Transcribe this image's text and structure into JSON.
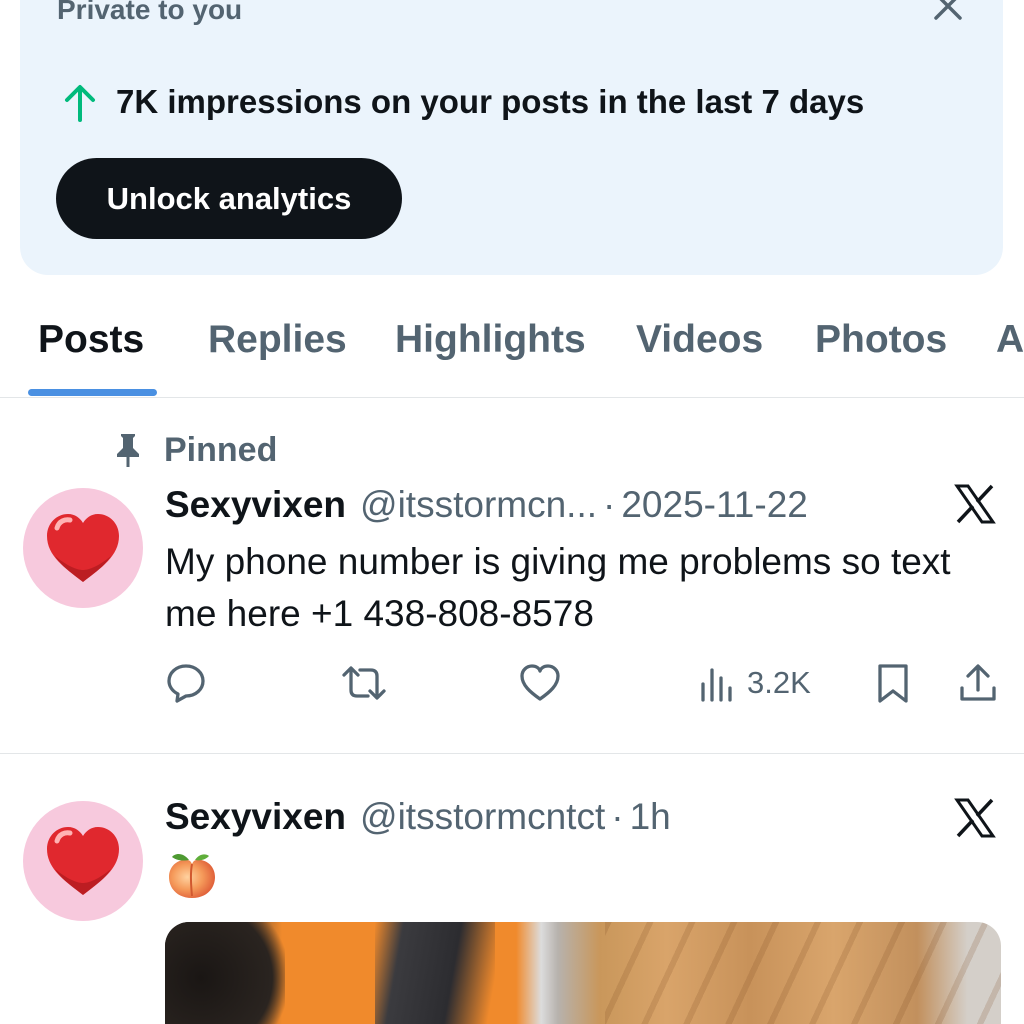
{
  "analytics_card": {
    "private_label": "Private to you",
    "stat_text": "7K impressions on your posts in the last 7 days",
    "unlock_label": "Unlock analytics",
    "accent_color": "#00ba7c"
  },
  "tabs": [
    {
      "label": "Posts",
      "active": true
    },
    {
      "label": "Replies"
    },
    {
      "label": "Highlights"
    },
    {
      "label": "Videos"
    },
    {
      "label": "Photos"
    },
    {
      "label": "A"
    }
  ],
  "posts": [
    {
      "pinned_label": "Pinned",
      "author": "Sexyvixen",
      "handle": "@itsstormcn...",
      "separator": "·",
      "date": "2025-11-22",
      "text": "My phone number is giving me problems so text me here +1 438-808-8578",
      "views": "3.2K",
      "avatar_icon": "heart-emoji",
      "platform_icon": "x-logo-icon"
    },
    {
      "author": "Sexyvixen",
      "handle": "@itsstormcntct",
      "separator": "·",
      "date": "1h",
      "text_icon": "peach-emoji",
      "avatar_icon": "heart-emoji",
      "platform_icon": "x-logo-icon"
    }
  ]
}
